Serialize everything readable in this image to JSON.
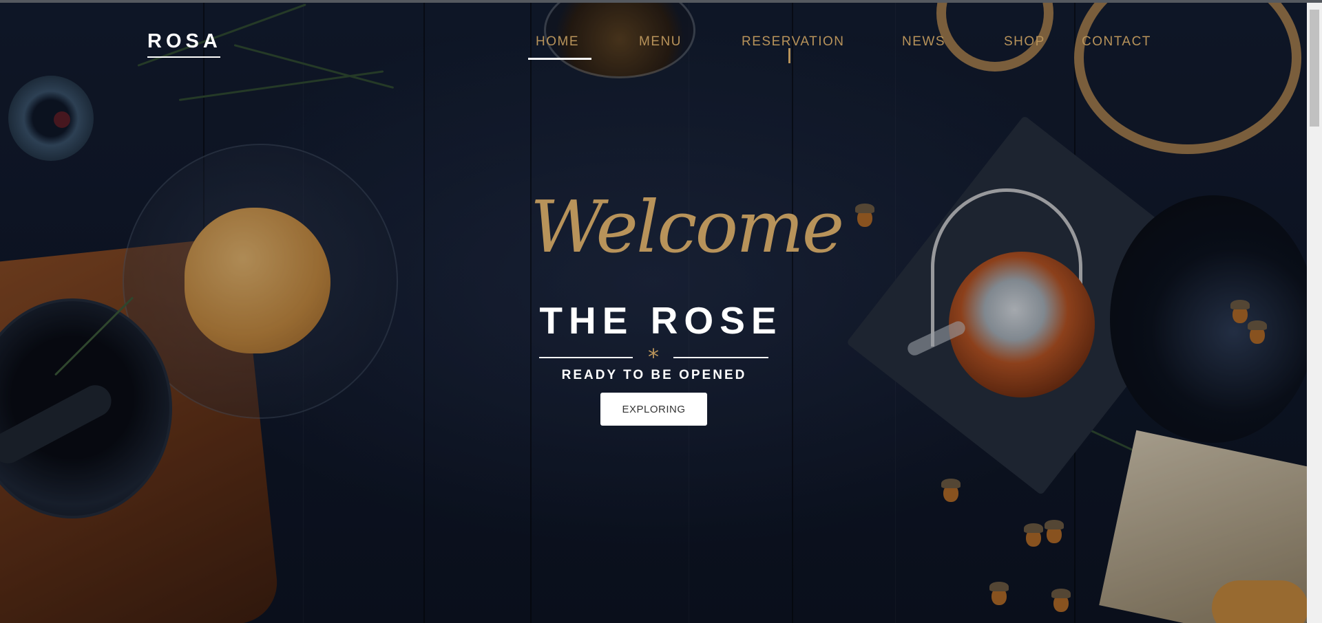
{
  "brand": {
    "logo_text": "ROSA"
  },
  "nav": {
    "items": [
      {
        "label": "HOME",
        "active": true
      },
      {
        "label": "MENU"
      },
      {
        "label": "RESERVATION"
      },
      {
        "label": "NEWS"
      },
      {
        "label": "SHOP"
      },
      {
        "label": "CONTACT"
      }
    ]
  },
  "hero": {
    "script_heading": "Welcome",
    "title": "THE ROSE",
    "divider_glyph": "*",
    "tagline": "READY TO BE OPENED",
    "cta_label": "EXPLORING"
  },
  "colors": {
    "accent_gold": "#b8935a",
    "background_navy": "#0e1525",
    "text_white": "#ffffff"
  }
}
